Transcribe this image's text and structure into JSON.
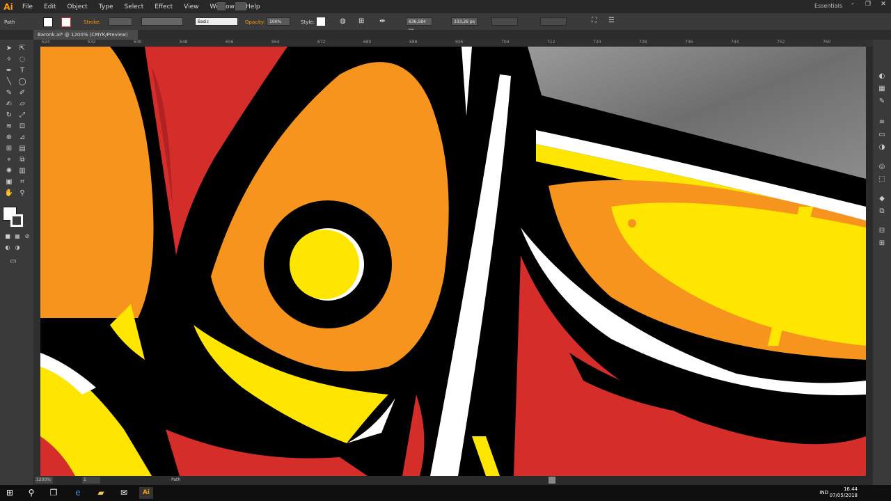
{
  "app": {
    "logo": "Ai",
    "workspace": "Essentials"
  },
  "menu": [
    "File",
    "Edit",
    "Object",
    "Type",
    "Select",
    "Effect",
    "View",
    "Window",
    "Help"
  ],
  "window_controls": {
    "minimize": "–",
    "maximize": "❐",
    "close": "✕"
  },
  "controlbar": {
    "selection_label": "Path",
    "stroke_label": "Stroke:",
    "brush_label": "Basic",
    "opacity_label": "Opacity:",
    "opacity_value": "100%",
    "style_label": "Style:",
    "x_value": "636,584 px",
    "y_value": "333,26 px"
  },
  "document_tab": {
    "title": "Baronk.ai* @ 1200% (CMYK/Preview)"
  },
  "ruler_top_labels": [
    "624",
    "632",
    "640",
    "648",
    "656",
    "664",
    "672",
    "680",
    "688",
    "696",
    "704",
    "712",
    "720",
    "728",
    "736",
    "744",
    "752",
    "760"
  ],
  "statusbar": {
    "zoom": "1200%",
    "page": "1",
    "tool": "Path"
  },
  "taskbar": {
    "language": "IND",
    "time": "16.44",
    "date": "07/05/2018"
  },
  "icons": {
    "windows": "windows-icon",
    "search": "search-icon",
    "taskview": "task-view-icon",
    "edge": "edge-icon",
    "explorer": "folder-icon",
    "mail": "mail-icon",
    "illustrator": "illustrator-icon"
  },
  "colors": {
    "orange": "#f7941d",
    "red": "#d42d2a",
    "yellow": "#ffe600",
    "black": "#000000",
    "white": "#ffffff",
    "accent": "#ff9a00"
  }
}
